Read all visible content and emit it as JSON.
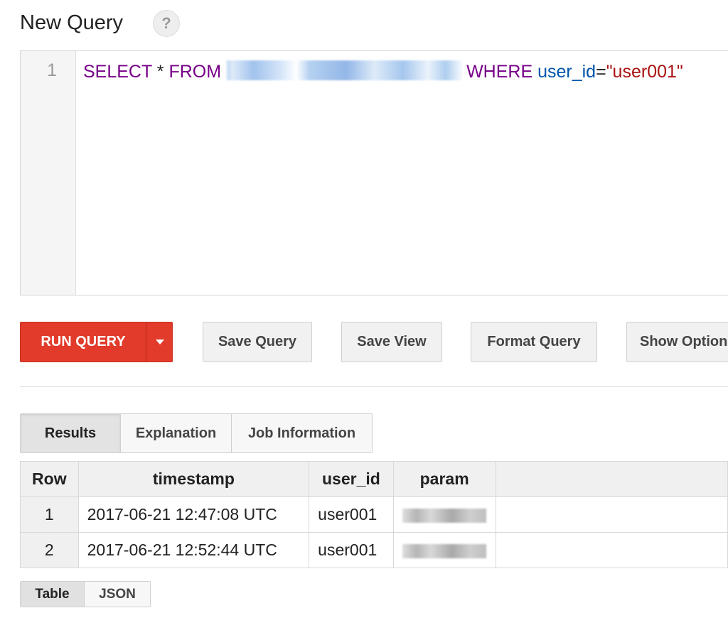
{
  "header": {
    "title": "New Query",
    "help_glyph": "?"
  },
  "editor": {
    "line_number": "1",
    "tokens": {
      "select": "SELECT",
      "star": "*",
      "from": "FROM",
      "where": "WHERE",
      "field": "user_id",
      "equals": "=",
      "value": "\"user001\""
    }
  },
  "toolbar": {
    "run_label": "RUN QUERY",
    "save_query_label": "Save Query",
    "save_view_label": "Save View",
    "format_query_label": "Format Query",
    "show_options_label": "Show Options"
  },
  "results_tabs": {
    "items": [
      {
        "label": "Results",
        "active": true
      },
      {
        "label": "Explanation",
        "active": false
      },
      {
        "label": "Job Information",
        "active": false
      }
    ]
  },
  "results_table": {
    "columns": [
      "Row",
      "timestamp",
      "user_id",
      "param"
    ],
    "rows": [
      {
        "row": "1",
        "timestamp": "2017-06-21 12:47:08 UTC",
        "user_id": "user001"
      },
      {
        "row": "2",
        "timestamp": "2017-06-21 12:52:44 UTC",
        "user_id": "user001"
      }
    ]
  },
  "format_toggle": {
    "table_label": "Table",
    "json_label": "JSON",
    "selected": "Table"
  },
  "colors": {
    "run_button": "#e23b2b",
    "keyword": "#770088",
    "variable": "#0055aa",
    "string": "#aa1111"
  },
  "icons": {
    "help": "help-icon",
    "dropdown": "chevron-down-icon"
  }
}
